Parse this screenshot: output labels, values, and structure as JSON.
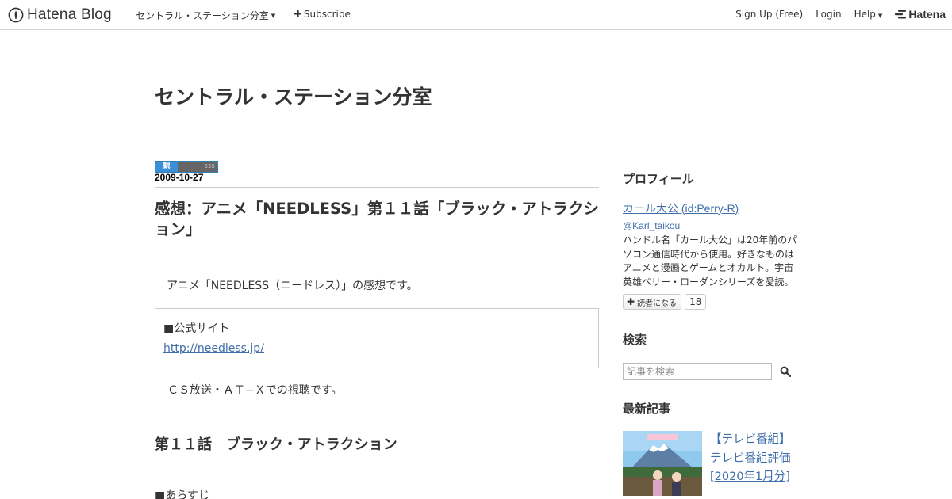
{
  "header": {
    "logo_text": "Hatena Blog",
    "blog_menu_label": "セントラル・ステーション分室",
    "subscribe_label": "Subscribe",
    "signup_label": "Sign Up (Free)",
    "login_label": "Login",
    "help_label": "Help",
    "hatena_label": "Hatena",
    "icons": [
      "hatena-blog-logo-icon",
      "caret-down-icon",
      "plus-icon",
      "hatena-mark-icon"
    ]
  },
  "blog": {
    "title": "セントラル・ステーション分室"
  },
  "entry": {
    "date_badge_left": "観",
    "date_badge_right": "555",
    "date": "2009-10-27",
    "title": "感想：アニメ「NEEDLESS」第１１話「ブラック・アトラクション」",
    "intro": "アニメ「NEEDLESS（ニードレス）」の感想です。",
    "official_label": "■公式サイト",
    "official_url": "http://needless.jp/",
    "broadcast": "ＣＳ放送・ＡＴ−Ｘでの視聴です。",
    "episode_heading": "第１１話　ブラック・アトラクション",
    "synopsis_label": "■あらすじ"
  },
  "sidebar": {
    "profile_heading": "プロフィール",
    "profile_name": "カール大公 (id:Perry-R)",
    "twitter": "@Karl_taikou",
    "profile_desc": "ハンドル名「カール大公」は20年前のパソコン通信時代から使用。好きなものはアニメと漫画とゲームとオカルト。宇宙英雄ペリー・ローダンシリーズを愛読。",
    "reader_button": "読者になる",
    "reader_count": "18",
    "search_heading": "検索",
    "search_placeholder": "記事を検索",
    "recent_heading": "最新記事",
    "recent_items": [
      {
        "title": "【テレビ番組】テレビ番組評価[2020年1月分]"
      }
    ]
  },
  "colors": {
    "link": "#3f6ea8",
    "text": "#333333",
    "border": "#cccccc"
  }
}
